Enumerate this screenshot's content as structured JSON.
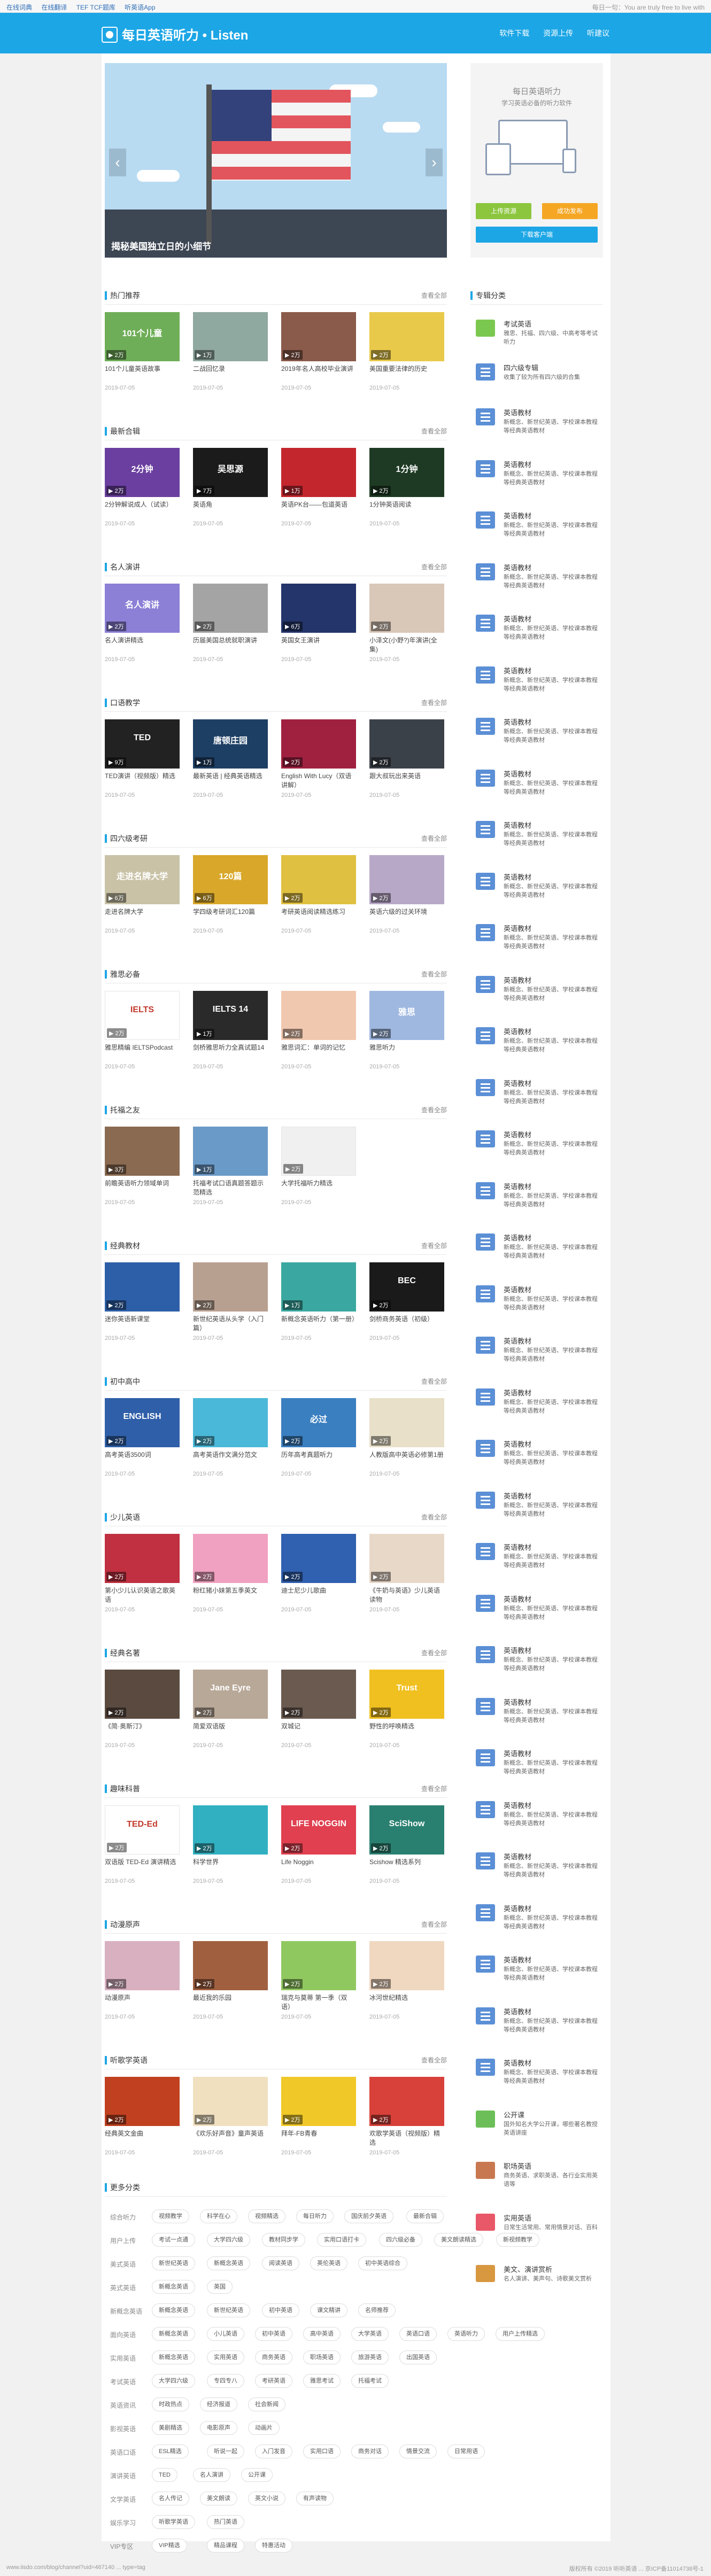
{
  "topbar": {
    "links": [
      "在线词典",
      "在线翻译",
      "TEF TCF题库",
      "听英语App"
    ],
    "right": "每日一句：You are truly free to live with"
  },
  "header": {
    "logo": "每日英语听力 • Listen",
    "links": [
      "软件下载",
      "资源上传",
      "听建议"
    ]
  },
  "banner": {
    "caption": "揭秘美国独立日的小细节",
    "prev": "‹",
    "next": "›"
  },
  "promo": {
    "title": "每日英语听力",
    "subtitle": "学习英语必备的听力软件",
    "upload": "上传资源",
    "publish": "成功发布",
    "download": "下载客户端"
  },
  "sections": [
    {
      "title": "热门推荐",
      "more": "查看全部",
      "items": [
        {
          "name": "101个儿童英语故事",
          "date": "2019-07-05",
          "count": "2万",
          "color": "#6fae58",
          "label": "101个儿童"
        },
        {
          "name": "二战回忆录",
          "date": "2019-07-05",
          "count": "1万",
          "color": "#8fa8a0",
          "label": ""
        },
        {
          "name": "2019年名人高校毕业演讲",
          "date": "2019-07-05",
          "count": "2万",
          "color": "#8a5a4a",
          "label": ""
        },
        {
          "name": "美国重要法律的历史",
          "date": "2019-07-05",
          "count": "2万",
          "color": "#e8c94a",
          "label": ""
        }
      ]
    },
    {
      "title": "最新合辑",
      "more": "查看全部",
      "items": [
        {
          "name": "2分钟解说成人（试读）",
          "date": "2019-07-05",
          "count": "2万",
          "color": "#6b3fa0",
          "label": "2分钟"
        },
        {
          "name": "英语角",
          "date": "2019-07-05",
          "count": "7万",
          "color": "#1b1b1b",
          "label": "吴思源"
        },
        {
          "name": "英语PK台——包道英语",
          "date": "2019-07-05",
          "count": "1万",
          "color": "#c4262e",
          "label": ""
        },
        {
          "name": "1分钟英语阅读",
          "date": "2019-07-05",
          "count": "2万",
          "color": "#1e3a24",
          "label": "1分钟"
        }
      ]
    },
    {
      "title": "名人演讲",
      "more": "查看全部",
      "items": [
        {
          "name": "名人演讲精选",
          "date": "2019-07-05",
          "count": "2万",
          "color": "#8b7fd6",
          "label": "名人演讲"
        },
        {
          "name": "历届美国总统就职演讲",
          "date": "2019-07-05",
          "count": "2万",
          "color": "#a4a4a4",
          "label": ""
        },
        {
          "name": "英国女王演讲",
          "date": "2019-07-05",
          "count": "6万",
          "color": "#24356b",
          "label": ""
        },
        {
          "name": "小泽文(小野?)年演讲(全集)",
          "date": "2019-07-05",
          "count": "2万",
          "color": "#d9c7b8",
          "label": ""
        }
      ]
    },
    {
      "title": "口语教学",
      "more": "查看全部",
      "items": [
        {
          "name": "TED演讲（视频版）精选",
          "date": "2019-07-05",
          "count": "9万",
          "color": "#222222",
          "label": "TED"
        },
        {
          "name": "最新英语 | 经典英语精选",
          "date": "2019-07-05",
          "count": "1万",
          "color": "#1d3f64",
          "label": "唐顿庄园"
        },
        {
          "name": "English With Lucy（双语讲解）",
          "date": "2019-07-05",
          "count": "2万",
          "color": "#a02040",
          "label": ""
        },
        {
          "name": "跟大叔玩出来英语",
          "date": "2019-07-05",
          "count": "2万",
          "color": "#3b4148",
          "label": ""
        }
      ]
    },
    {
      "title": "四六级考研",
      "more": "查看全部",
      "items": [
        {
          "name": "走进名牌大学",
          "date": "2019-07-05",
          "count": "6万",
          "color": "#c9c2a6",
          "label": "走进名牌大学"
        },
        {
          "name": "学四级考研词汇120篇",
          "date": "2019-07-05",
          "count": "6万",
          "color": "#d9a82a",
          "label": "120篇"
        },
        {
          "name": "考研英语阅读精选练习",
          "date": "2019-07-05",
          "count": "2万",
          "color": "#e0c040",
          "label": ""
        },
        {
          "name": "英语六级的过关环境",
          "date": "2019-07-05",
          "count": "2万",
          "color": "#b8a8c8",
          "label": ""
        }
      ]
    },
    {
      "title": "雅思必备",
      "more": "查看全部",
      "items": [
        {
          "name": "雅思精编 IELTSPodcast",
          "date": "2019-07-05",
          "count": "2万",
          "color": "#ffffff",
          "label": "IELTS"
        },
        {
          "name": "剑桥雅思听力全真试题14",
          "date": "2019-07-05",
          "count": "1万",
          "color": "#2a2a2a",
          "label": "IELTS 14"
        },
        {
          "name": "雅思词汇：单词的记忆",
          "date": "2019-07-05",
          "count": "2万",
          "color": "#f0c8b0",
          "label": ""
        },
        {
          "name": "雅思听力",
          "date": "2019-07-05",
          "count": "2万",
          "color": "#9fb8e0",
          "label": "雅思"
        }
      ]
    },
    {
      "title": "托福之友",
      "more": "查看全部",
      "items": [
        {
          "name": "前瞻英语听力领域单词",
          "date": "2019-07-05",
          "count": "3万",
          "color": "#8a6a50",
          "label": ""
        },
        {
          "name": "托福考试口语真题答题示范精选",
          "date": "2019-07-05",
          "count": "1万",
          "color": "#6a9ac8",
          "label": ""
        },
        {
          "name": "大学托福听力精选",
          "date": "2019-07-05",
          "count": "2万",
          "color": "#f0f0f0",
          "label": ""
        }
      ]
    },
    {
      "title": "经典教材",
      "more": "查看全部",
      "items": [
        {
          "name": "迷你英语新课堂",
          "date": "2019-07-05",
          "count": "2万",
          "color": "#2d5fa8",
          "label": ""
        },
        {
          "name": "新世纪英语从头学（入门篇）",
          "date": "2019-07-05",
          "count": "2万",
          "color": "#b8a090",
          "label": ""
        },
        {
          "name": "新概念英语听力（第一册）",
          "date": "2019-07-05",
          "count": "1万",
          "color": "#3aa8a0",
          "label": ""
        },
        {
          "name": "剑桥商务英语（初级）",
          "date": "2019-07-05",
          "count": "2万",
          "color": "#1a1a1a",
          "label": "BEC"
        }
      ]
    },
    {
      "title": "初中高中",
      "more": "查看全部",
      "items": [
        {
          "name": "高考英语3500词",
          "date": "2019-07-05",
          "count": "2万",
          "color": "#2f5fa8",
          "label": "ENGLISH"
        },
        {
          "name": "高考英语作文满分范文",
          "date": "2019-07-05",
          "count": "2万",
          "color": "#4ab8d8",
          "label": ""
        },
        {
          "name": "历年高考真题听力",
          "date": "2019-07-05",
          "count": "2万",
          "color": "#3a7fc0",
          "label": "必过"
        },
        {
          "name": "人教版高中英语必修第1册",
          "date": "2019-07-05",
          "count": "2万",
          "color": "#e8e0c8",
          "label": ""
        }
      ]
    },
    {
      "title": "少儿英语",
      "more": "查看全部",
      "items": [
        {
          "name": "第小少儿认识英语之歌英语",
          "date": "2019-07-05",
          "count": "2万",
          "color": "#c03040",
          "label": ""
        },
        {
          "name": "粉红猪小妹第五季英文",
          "date": "2019-07-05",
          "count": "2万",
          "color": "#f0a0c0",
          "label": ""
        },
        {
          "name": "迪士尼少儿歌曲",
          "date": "2019-07-05",
          "count": "2万",
          "color": "#3060b0",
          "label": ""
        },
        {
          "name": "《牛奶与英语》少儿英语读物",
          "date": "2019-07-05",
          "count": "2万",
          "color": "#e8d8c8",
          "label": ""
        }
      ]
    },
    {
      "title": "经典名著",
      "more": "查看全部",
      "items": [
        {
          "name": "《简·奥斯汀》",
          "date": "2019-07-05",
          "count": "2万",
          "color": "#5a4a40",
          "label": ""
        },
        {
          "name": "简爱双语版",
          "date": "2019-07-05",
          "count": "2万",
          "color": "#b8a898",
          "label": "Jane Eyre"
        },
        {
          "name": "双城记",
          "date": "2019-07-05",
          "count": "2万",
          "color": "#6a5a50",
          "label": ""
        },
        {
          "name": "野性的呼唤精选",
          "date": "2019-07-05",
          "count": "2万",
          "color": "#f0c020",
          "label": "Trust"
        }
      ]
    },
    {
      "title": "趣味科普",
      "more": "查看全部",
      "items": [
        {
          "name": "双语版 TED-Ed 演讲精选",
          "date": "2019-07-05",
          "count": "2万",
          "color": "#ffffff",
          "label": "TED-Ed"
        },
        {
          "name": "科学世界",
          "date": "2019-07-05",
          "count": "2万",
          "color": "#30b0c0",
          "label": ""
        },
        {
          "name": "Life Noggin",
          "date": "2019-07-05",
          "count": "2万",
          "color": "#e04050",
          "label": "LIFE NOGGIN"
        },
        {
          "name": "Scishow 精选系列",
          "date": "2019-07-05",
          "count": "2万",
          "color": "#2a8070",
          "label": "SciShow"
        }
      ]
    },
    {
      "title": "动漫原声",
      "more": "查看全部",
      "items": [
        {
          "name": "动漫原声",
          "date": "2019-07-05",
          "count": "2万",
          "color": "#d8b0c0",
          "label": ""
        },
        {
          "name": "最近我的乐园",
          "date": "2019-07-05",
          "count": "2万",
          "color": "#a06040",
          "label": ""
        },
        {
          "name": "瑞克与莫蒂 第一季（双语）",
          "date": "2019-07-05",
          "count": "2万",
          "color": "#90c860",
          "label": ""
        },
        {
          "name": "冰河世纪精选",
          "date": "2019-07-05",
          "count": "2万",
          "color": "#f0d8c0",
          "label": ""
        }
      ]
    },
    {
      "title": "听歌学英语",
      "more": "查看全部",
      "items": [
        {
          "name": "经典英文金曲",
          "date": "2019-07-05",
          "count": "2万",
          "color": "#c04020",
          "label": ""
        },
        {
          "name": "《欢乐好声音》童声英语",
          "date": "2019-07-05",
          "count": "2万",
          "color": "#f0e0c0",
          "label": ""
        },
        {
          "name": "拜年-FB青春",
          "date": "2019-07-05",
          "count": "2万",
          "color": "#f0c828",
          "label": ""
        },
        {
          "name": "欢歌学英语（视频版）精选",
          "date": "2019-07-05",
          "count": "2万",
          "color": "#d8403a",
          "label": ""
        }
      ]
    }
  ],
  "sidebar": {
    "title": "专辑分类",
    "items": [
      {
        "title": "考试英语",
        "desc": "雅思、托福、四六级、中高考等考试听力",
        "color": "#7bc850"
      },
      {
        "title": "四六级专辑",
        "desc": "收集了较为所有四六级的合集",
        "color": "#5b8fd6"
      },
      {
        "title": "英语教材",
        "desc": "新概念、新世纪英语、学校课本教程等经典英语教材",
        "color": "#5b8fd6"
      },
      {
        "title": "英语教材",
        "desc": "新概念、新世纪英语、学校课本教程等经典英语教材",
        "color": "#5b8fd6"
      },
      {
        "title": "英语教材",
        "desc": "新概念、新世纪英语、学校课本教程等经典英语教材",
        "color": "#5b8fd6"
      },
      {
        "title": "英语教材",
        "desc": "新概念、新世纪英语、学校课本教程等经典英语教材",
        "color": "#5b8fd6"
      },
      {
        "title": "英语教材",
        "desc": "新概念、新世纪英语、学校课本教程等经典英语教材",
        "color": "#5b8fd6"
      },
      {
        "title": "英语教材",
        "desc": "新概念、新世纪英语、学校课本教程等经典英语教材",
        "color": "#5b8fd6"
      },
      {
        "title": "英语教材",
        "desc": "新概念、新世纪英语、学校课本教程等经典英语教材",
        "color": "#5b8fd6"
      },
      {
        "title": "英语教材",
        "desc": "新概念、新世纪英语、学校课本教程等经典英语教材",
        "color": "#5b8fd6"
      },
      {
        "title": "英语教材",
        "desc": "新概念、新世纪英语、学校课本教程等经典英语教材",
        "color": "#5b8fd6"
      },
      {
        "title": "英语教材",
        "desc": "新概念、新世纪英语、学校课本教程等经典英语教材",
        "color": "#5b8fd6"
      },
      {
        "title": "英语教材",
        "desc": "新概念、新世纪英语、学校课本教程等经典英语教材",
        "color": "#5b8fd6"
      },
      {
        "title": "英语教材",
        "desc": "新概念、新世纪英语、学校课本教程等经典英语教材",
        "color": "#5b8fd6"
      },
      {
        "title": "英语教材",
        "desc": "新概念、新世纪英语、学校课本教程等经典英语教材",
        "color": "#5b8fd6"
      },
      {
        "title": "英语教材",
        "desc": "新概念、新世纪英语、学校课本教程等经典英语教材",
        "color": "#5b8fd6"
      },
      {
        "title": "英语教材",
        "desc": "新概念、新世纪英语、学校课本教程等经典英语教材",
        "color": "#5b8fd6"
      },
      {
        "title": "英语教材",
        "desc": "新概念、新世纪英语、学校课本教程等经典英语教材",
        "color": "#5b8fd6"
      },
      {
        "title": "英语教材",
        "desc": "新概念、新世纪英语、学校课本教程等经典英语教材",
        "color": "#5b8fd6"
      },
      {
        "title": "英语教材",
        "desc": "新概念、新世纪英语、学校课本教程等经典英语教材",
        "color": "#5b8fd6"
      },
      {
        "title": "英语教材",
        "desc": "新概念、新世纪英语、学校课本教程等经典英语教材",
        "color": "#5b8fd6"
      },
      {
        "title": "英语教材",
        "desc": "新概念、新世纪英语、学校课本教程等经典英语教材",
        "color": "#5b8fd6"
      },
      {
        "title": "英语教材",
        "desc": "新概念、新世纪英语、学校课本教程等经典英语教材",
        "color": "#5b8fd6"
      },
      {
        "title": "英语教材",
        "desc": "新概念、新世纪英语、学校课本教程等经典英语教材",
        "color": "#5b8fd6"
      },
      {
        "title": "英语教材",
        "desc": "新概念、新世纪英语、学校课本教程等经典英语教材",
        "color": "#5b8fd6"
      },
      {
        "title": "英语教材",
        "desc": "新概念、新世纪英语、学校课本教程等经典英语教材",
        "color": "#5b8fd6"
      },
      {
        "title": "英语教材",
        "desc": "新概念、新世纪英语、学校课本教程等经典英语教材",
        "color": "#5b8fd6"
      },
      {
        "title": "英语教材",
        "desc": "新概念、新世纪英语、学校课本教程等经典英语教材",
        "color": "#5b8fd6"
      },
      {
        "title": "英语教材",
        "desc": "新概念、新世纪英语、学校课本教程等经典英语教材",
        "color": "#5b8fd6"
      },
      {
        "title": "英语教材",
        "desc": "新概念、新世纪英语、学校课本教程等经典英语教材",
        "color": "#5b8fd6"
      },
      {
        "title": "英语教材",
        "desc": "新概念、新世纪英语、学校课本教程等经典英语教材",
        "color": "#5b8fd6"
      },
      {
        "title": "英语教材",
        "desc": "新概念、新世纪英语、学校课本教程等经典英语教材",
        "color": "#5b8fd6"
      },
      {
        "title": "英语教材",
        "desc": "新概念、新世纪英语、学校课本教程等经典英语教材",
        "color": "#5b8fd6"
      },
      {
        "title": "英语教材",
        "desc": "新概念、新世纪英语、学校课本教程等经典英语教材",
        "color": "#5b8fd6"
      },
      {
        "title": "英语教材",
        "desc": "新概念、新世纪英语、学校课本教程等经典英语教材",
        "color": "#5b8fd6"
      },
      {
        "title": "公开课",
        "desc": "国外知名大学公开课，哪些著名教授英语讲座",
        "color": "#6cbf58"
      },
      {
        "title": "职场英语",
        "desc": "商务英语、求职英语、各行业实用英语等",
        "color": "#c87850"
      },
      {
        "title": "实用英语",
        "desc": "日常生活常用、常用情景对话、百科解析",
        "color": "#e85868"
      },
      {
        "title": "美文、演讲赏析",
        "desc": "名人演讲、美声句、诗歌美文赏析",
        "color": "#d89840"
      }
    ]
  },
  "categories": {
    "title": "更多分类",
    "rows": [
      {
        "label": "综合听力",
        "tags": [
          "视频教学",
          "科学在心",
          "视频精选",
          "每日听力",
          "国庆前夕英语",
          "最新合辑"
        ]
      },
      {
        "label": "用户上传",
        "tags": [
          "考试一点通",
          "大学四六级",
          "教材同步学",
          "实用口语打卡",
          "四六级必备",
          "美文朗读精选",
          "新视频教学"
        ]
      },
      {
        "label": "美式英语",
        "tags": [
          "新世纪英语",
          "新概念英语",
          "阅读英语",
          "英伦英语",
          "初中英语综合"
        ]
      },
      {
        "label": "英式英语",
        "tags": [
          "新概念英语",
          "英国"
        ]
      },
      {
        "label": "新概念英语",
        "tags": [
          "新概念英语",
          "新世纪英语",
          "初中英语",
          "课文精讲",
          "名师推荐"
        ]
      },
      {
        "label": "面向英语",
        "tags": [
          "新概念英语",
          "小儿英语",
          "初中英语",
          "高中英语",
          "大学英语",
          "英语口语",
          "英语听力",
          "用户上传精选"
        ]
      },
      {
        "label": "实用英语",
        "tags": [
          "新概念英语",
          "实用英语",
          "商务英语",
          "职场英语",
          "旅游英语",
          "出国英语"
        ]
      },
      {
        "label": "考试英语",
        "tags": [
          "大学四六级",
          "专四专八",
          "考研英语",
          "雅思考试",
          "托福考试"
        ]
      },
      {
        "label": "英语资讯",
        "tags": [
          "时政热点",
          "经济报道",
          "社会新闻"
        ]
      },
      {
        "label": "影视英语",
        "tags": [
          "美剧精选",
          "电影原声",
          "动画片"
        ]
      },
      {
        "label": "英语口语",
        "tags": [
          "ESL精选",
          "听说一起",
          "入门发音",
          "实用口语",
          "商务对话",
          "情景交流",
          "日常用语"
        ]
      },
      {
        "label": "演讲英语",
        "tags": [
          "TED",
          "名人演讲",
          "公开课"
        ]
      },
      {
        "label": "文学英语",
        "tags": [
          "名人传记",
          "美文朗读",
          "英文小说",
          "有声读物"
        ]
      },
      {
        "label": "娱乐学习",
        "tags": [
          "听歌学英语",
          "热门英语"
        ]
      },
      {
        "label": "VIP专区",
        "tags": [
          "VIP精选",
          "精品课程",
          "特惠活动"
        ]
      }
    ]
  },
  "footer": {
    "url": "www.iisdo.com/blog/channel?uid=467140 ... type=tag",
    "copyright": "版权所有 ©2019 听听英语 ... 京ICP备11014738号-1"
  }
}
